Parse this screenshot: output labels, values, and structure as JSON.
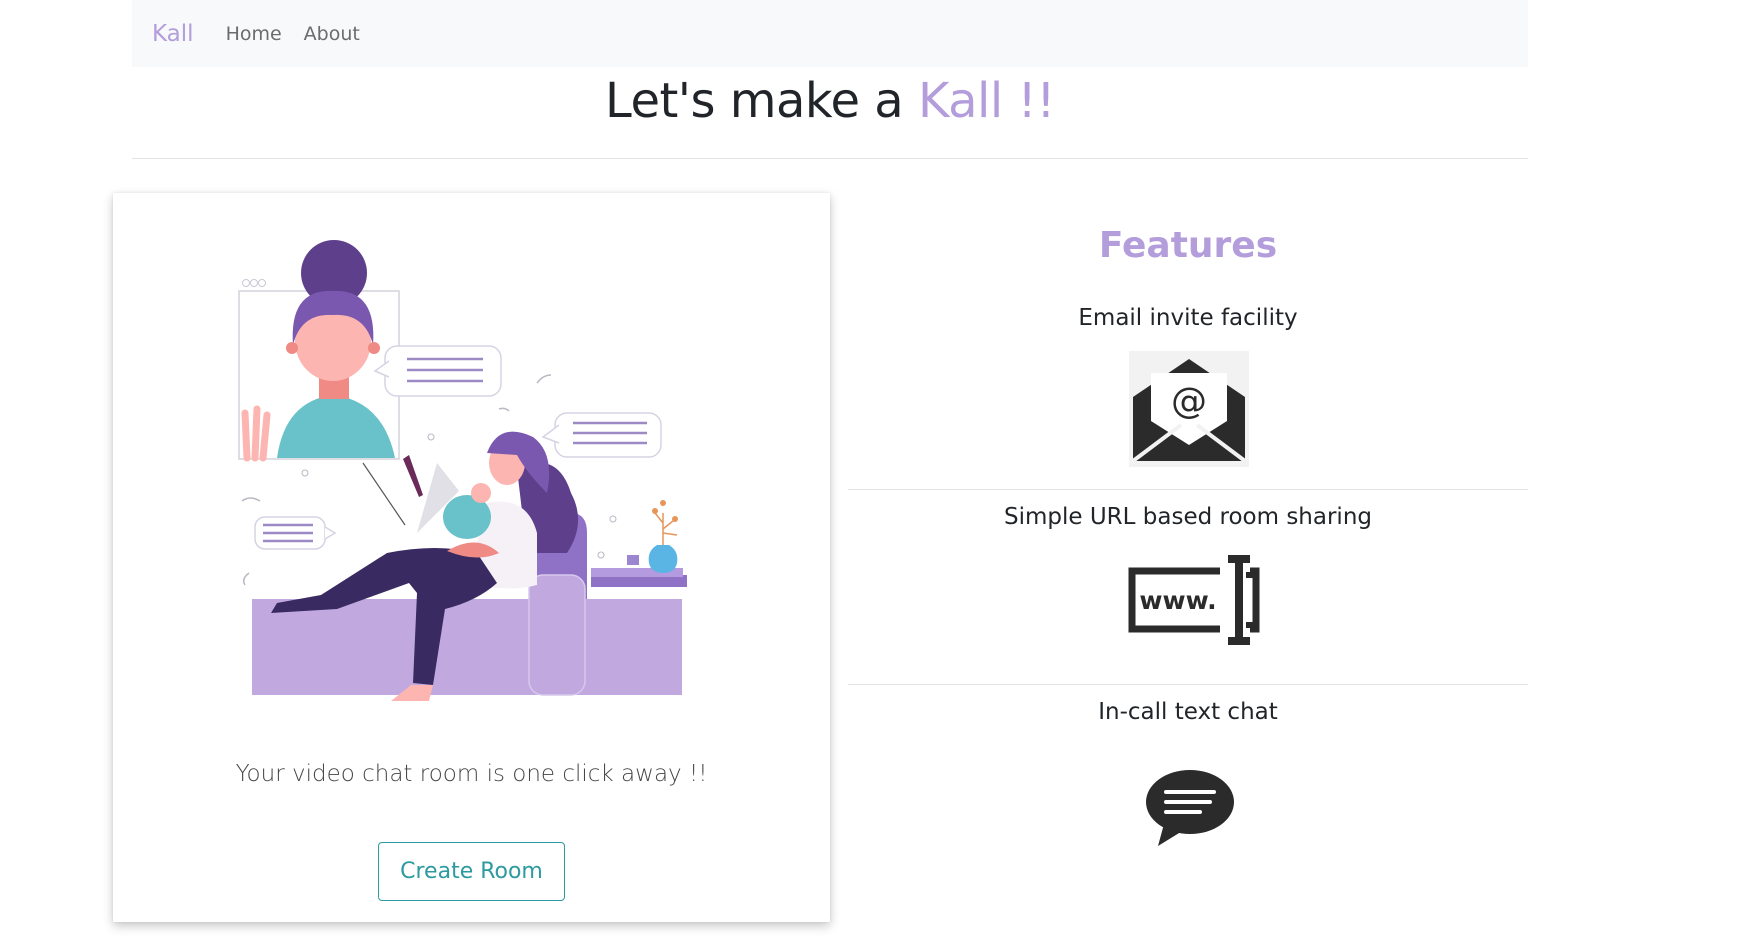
{
  "nav": {
    "brand": "Kall",
    "links": [
      "Home",
      "About"
    ]
  },
  "hero": {
    "title_prefix": "Let's make a ",
    "title_accent": "Kall !!"
  },
  "card": {
    "illustration": "woman-video-calling-illustration",
    "text": "Your video chat room is one click away !!",
    "button_label": "Create Room"
  },
  "features": {
    "title": "Features",
    "items": [
      {
        "label": "Email invite facility",
        "icon": "email-envelope-icon"
      },
      {
        "label": "Simple URL based room sharing",
        "icon": "www-url-icon"
      },
      {
        "label": "In-call text chat",
        "icon": "chat-bubble-icon"
      }
    ]
  },
  "colors": {
    "accent": "#b39ddb",
    "button": "#2d9a9f",
    "navbar_bg": "#f8f9fa"
  }
}
